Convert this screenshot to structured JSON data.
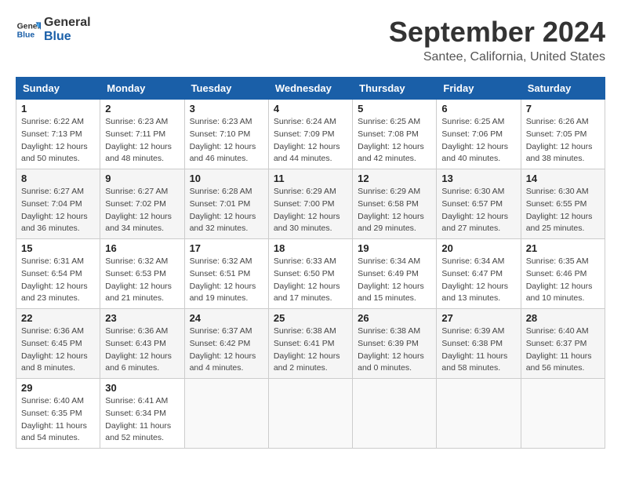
{
  "header": {
    "logo_line1": "General",
    "logo_line2": "Blue",
    "title": "September 2024",
    "subtitle": "Santee, California, United States"
  },
  "columns": [
    "Sunday",
    "Monday",
    "Tuesday",
    "Wednesday",
    "Thursday",
    "Friday",
    "Saturday"
  ],
  "weeks": [
    [
      {
        "day": "1",
        "sunrise": "Sunrise: 6:22 AM",
        "sunset": "Sunset: 7:13 PM",
        "daylight": "Daylight: 12 hours and 50 minutes."
      },
      {
        "day": "2",
        "sunrise": "Sunrise: 6:23 AM",
        "sunset": "Sunset: 7:11 PM",
        "daylight": "Daylight: 12 hours and 48 minutes."
      },
      {
        "day": "3",
        "sunrise": "Sunrise: 6:23 AM",
        "sunset": "Sunset: 7:10 PM",
        "daylight": "Daylight: 12 hours and 46 minutes."
      },
      {
        "day": "4",
        "sunrise": "Sunrise: 6:24 AM",
        "sunset": "Sunset: 7:09 PM",
        "daylight": "Daylight: 12 hours and 44 minutes."
      },
      {
        "day": "5",
        "sunrise": "Sunrise: 6:25 AM",
        "sunset": "Sunset: 7:08 PM",
        "daylight": "Daylight: 12 hours and 42 minutes."
      },
      {
        "day": "6",
        "sunrise": "Sunrise: 6:25 AM",
        "sunset": "Sunset: 7:06 PM",
        "daylight": "Daylight: 12 hours and 40 minutes."
      },
      {
        "day": "7",
        "sunrise": "Sunrise: 6:26 AM",
        "sunset": "Sunset: 7:05 PM",
        "daylight": "Daylight: 12 hours and 38 minutes."
      }
    ],
    [
      {
        "day": "8",
        "sunrise": "Sunrise: 6:27 AM",
        "sunset": "Sunset: 7:04 PM",
        "daylight": "Daylight: 12 hours and 36 minutes."
      },
      {
        "day": "9",
        "sunrise": "Sunrise: 6:27 AM",
        "sunset": "Sunset: 7:02 PM",
        "daylight": "Daylight: 12 hours and 34 minutes."
      },
      {
        "day": "10",
        "sunrise": "Sunrise: 6:28 AM",
        "sunset": "Sunset: 7:01 PM",
        "daylight": "Daylight: 12 hours and 32 minutes."
      },
      {
        "day": "11",
        "sunrise": "Sunrise: 6:29 AM",
        "sunset": "Sunset: 7:00 PM",
        "daylight": "Daylight: 12 hours and 30 minutes."
      },
      {
        "day": "12",
        "sunrise": "Sunrise: 6:29 AM",
        "sunset": "Sunset: 6:58 PM",
        "daylight": "Daylight: 12 hours and 29 minutes."
      },
      {
        "day": "13",
        "sunrise": "Sunrise: 6:30 AM",
        "sunset": "Sunset: 6:57 PM",
        "daylight": "Daylight: 12 hours and 27 minutes."
      },
      {
        "day": "14",
        "sunrise": "Sunrise: 6:30 AM",
        "sunset": "Sunset: 6:55 PM",
        "daylight": "Daylight: 12 hours and 25 minutes."
      }
    ],
    [
      {
        "day": "15",
        "sunrise": "Sunrise: 6:31 AM",
        "sunset": "Sunset: 6:54 PM",
        "daylight": "Daylight: 12 hours and 23 minutes."
      },
      {
        "day": "16",
        "sunrise": "Sunrise: 6:32 AM",
        "sunset": "Sunset: 6:53 PM",
        "daylight": "Daylight: 12 hours and 21 minutes."
      },
      {
        "day": "17",
        "sunrise": "Sunrise: 6:32 AM",
        "sunset": "Sunset: 6:51 PM",
        "daylight": "Daylight: 12 hours and 19 minutes."
      },
      {
        "day": "18",
        "sunrise": "Sunrise: 6:33 AM",
        "sunset": "Sunset: 6:50 PM",
        "daylight": "Daylight: 12 hours and 17 minutes."
      },
      {
        "day": "19",
        "sunrise": "Sunrise: 6:34 AM",
        "sunset": "Sunset: 6:49 PM",
        "daylight": "Daylight: 12 hours and 15 minutes."
      },
      {
        "day": "20",
        "sunrise": "Sunrise: 6:34 AM",
        "sunset": "Sunset: 6:47 PM",
        "daylight": "Daylight: 12 hours and 13 minutes."
      },
      {
        "day": "21",
        "sunrise": "Sunrise: 6:35 AM",
        "sunset": "Sunset: 6:46 PM",
        "daylight": "Daylight: 12 hours and 10 minutes."
      }
    ],
    [
      {
        "day": "22",
        "sunrise": "Sunrise: 6:36 AM",
        "sunset": "Sunset: 6:45 PM",
        "daylight": "Daylight: 12 hours and 8 minutes."
      },
      {
        "day": "23",
        "sunrise": "Sunrise: 6:36 AM",
        "sunset": "Sunset: 6:43 PM",
        "daylight": "Daylight: 12 hours and 6 minutes."
      },
      {
        "day": "24",
        "sunrise": "Sunrise: 6:37 AM",
        "sunset": "Sunset: 6:42 PM",
        "daylight": "Daylight: 12 hours and 4 minutes."
      },
      {
        "day": "25",
        "sunrise": "Sunrise: 6:38 AM",
        "sunset": "Sunset: 6:41 PM",
        "daylight": "Daylight: 12 hours and 2 minutes."
      },
      {
        "day": "26",
        "sunrise": "Sunrise: 6:38 AM",
        "sunset": "Sunset: 6:39 PM",
        "daylight": "Daylight: 12 hours and 0 minutes."
      },
      {
        "day": "27",
        "sunrise": "Sunrise: 6:39 AM",
        "sunset": "Sunset: 6:38 PM",
        "daylight": "Daylight: 11 hours and 58 minutes."
      },
      {
        "day": "28",
        "sunrise": "Sunrise: 6:40 AM",
        "sunset": "Sunset: 6:37 PM",
        "daylight": "Daylight: 11 hours and 56 minutes."
      }
    ],
    [
      {
        "day": "29",
        "sunrise": "Sunrise: 6:40 AM",
        "sunset": "Sunset: 6:35 PM",
        "daylight": "Daylight: 11 hours and 54 minutes."
      },
      {
        "day": "30",
        "sunrise": "Sunrise: 6:41 AM",
        "sunset": "Sunset: 6:34 PM",
        "daylight": "Daylight: 11 hours and 52 minutes."
      },
      null,
      null,
      null,
      null,
      null
    ]
  ]
}
